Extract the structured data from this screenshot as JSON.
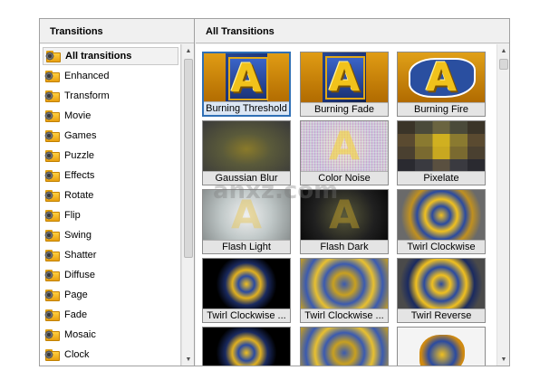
{
  "left_panel": {
    "title": "Transitions",
    "items": [
      {
        "label": "All transitions",
        "selected": true,
        "icon": "folder-gear-icon"
      },
      {
        "label": "Enhanced",
        "icon": "folder-gear-icon"
      },
      {
        "label": "Transform",
        "icon": "folder-gear-icon"
      },
      {
        "label": "Movie",
        "icon": "folder-gear-icon"
      },
      {
        "label": "Games",
        "icon": "folder-gear-icon"
      },
      {
        "label": "Puzzle",
        "icon": "folder-gear-icon"
      },
      {
        "label": "Effects",
        "icon": "folder-gear-icon"
      },
      {
        "label": "Rotate",
        "icon": "folder-gear-icon"
      },
      {
        "label": "Flip",
        "icon": "folder-gear-icon"
      },
      {
        "label": "Swing",
        "icon": "folder-gear-icon"
      },
      {
        "label": "Shatter",
        "icon": "folder-gear-icon"
      },
      {
        "label": "Diffuse",
        "icon": "folder-gear-icon"
      },
      {
        "label": "Page",
        "icon": "folder-gear-icon"
      },
      {
        "label": "Fade",
        "icon": "folder-gear-icon"
      },
      {
        "label": "Mosaic",
        "icon": "folder-gear-icon"
      },
      {
        "label": "Clock",
        "icon": "folder-gear-icon"
      }
    ]
  },
  "right_panel": {
    "title": "All Transitions",
    "thumbnails": [
      {
        "label": "Burning Threshold",
        "selected": true
      },
      {
        "label": "Burning Fade"
      },
      {
        "label": "Burning Fire"
      },
      {
        "label": "Gaussian Blur"
      },
      {
        "label": "Color Noise"
      },
      {
        "label": "Pixelate"
      },
      {
        "label": "Flash Light"
      },
      {
        "label": "Flash Dark"
      },
      {
        "label": "Twirl Clockwise"
      },
      {
        "label": "Twirl Clockwise ..."
      },
      {
        "label": "Twirl Clockwise ..."
      },
      {
        "label": "Twirl Reverse"
      },
      {
        "label": ""
      },
      {
        "label": ""
      },
      {
        "label": ""
      }
    ]
  },
  "watermark": {
    "text": "anxz.com"
  },
  "colors": {
    "selection_border": "#2f6fb5",
    "folder": "#f0b020",
    "panel_bg": "#f0f0f0"
  }
}
